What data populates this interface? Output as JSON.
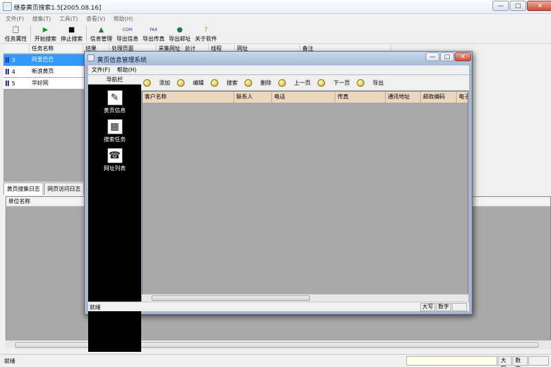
{
  "main": {
    "title": "继泰黄页搜索1.5[2005.08.16]",
    "menu": [
      "文件(F)",
      "搜集(T)",
      "工具(T)",
      "查看(V)",
      "帮助(H)"
    ],
    "toolbar": [
      {
        "label": "任务属性",
        "icon": "properties-icon"
      },
      {
        "label": "开始搜索",
        "icon": "play-icon"
      },
      {
        "label": "停止搜索",
        "icon": "stop-icon"
      },
      {
        "label": "信息管理",
        "icon": "manage-icon"
      },
      {
        "label": "导出信息",
        "icon": "export-com-icon",
        "badge": "COM"
      },
      {
        "label": "导出传真",
        "icon": "export-fax-icon",
        "badge": "FAX"
      },
      {
        "label": "导出邮址",
        "icon": "export-mail-icon"
      },
      {
        "label": "关于软件",
        "icon": "about-icon"
      }
    ],
    "task_columns": [
      "",
      "任务名称",
      "结果",
      "处理页面",
      "采集网址",
      "总计",
      "线程",
      "网址",
      "备注"
    ],
    "tasks": [
      {
        "num": "3",
        "name": "阿里巴巴",
        "selected": true
      },
      {
        "num": "4",
        "name": "新浪黄页",
        "selected": false
      },
      {
        "num": "5",
        "name": "华好网",
        "selected": false
      }
    ],
    "log_tabs": [
      "黄页搜集日志",
      "网页访问日志"
    ],
    "log_column": "单位名称",
    "status": {
      "text": "就绪",
      "caps": "大写",
      "num": "数字"
    }
  },
  "child": {
    "title": "黄页信息管理系统",
    "menu": [
      "文件(F)",
      "帮助(H)"
    ],
    "nav_header": "导航栏",
    "nav_items": [
      {
        "label": "黄页信息",
        "icon": "yellowpages-icon"
      },
      {
        "label": "搜索任务",
        "icon": "search-task-icon"
      },
      {
        "label": "网址列表",
        "icon": "url-list-icon"
      }
    ],
    "toolbar": [
      "添加",
      "编辑",
      "搜索",
      "删除",
      "上一页",
      "下一页",
      "导出"
    ],
    "grid_columns": [
      "客户名称",
      "联系人",
      "电话",
      "传真",
      "通讯地址",
      "邮政编码",
      "电子"
    ],
    "status": {
      "text": "就绪",
      "caps": "大写",
      "num": "数字"
    }
  }
}
